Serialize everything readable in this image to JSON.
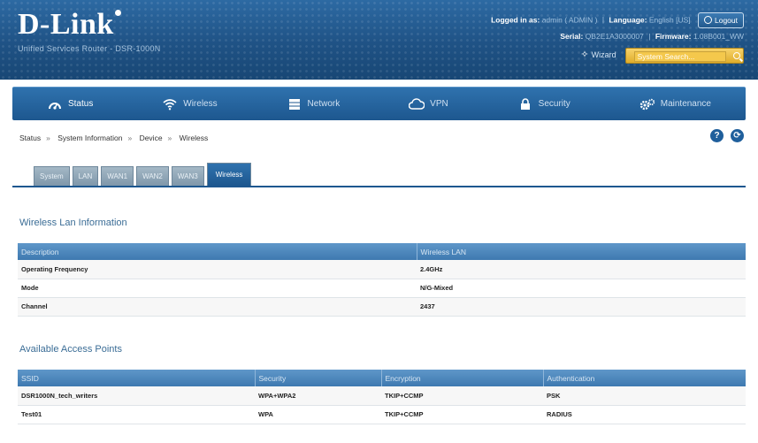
{
  "header": {
    "logo": "D-Link",
    "tagline": "Unified Services Router - DSR-1000N",
    "logged_in_label": "Logged in as:",
    "logged_in_value": "admin ( ADMIN )",
    "language_label": "Language:",
    "language_value": "English [US]",
    "logout_label": "Logout",
    "serial_label": "Serial:",
    "serial_value": "QB2E1A3000007",
    "firmware_label": "Firmware:",
    "firmware_value": "1.08B001_WW",
    "wizard_label": "Wizard",
    "search_placeholder": "System Search..."
  },
  "nav": {
    "items": [
      {
        "label": "Status",
        "icon": "dashboard-icon",
        "active": true
      },
      {
        "label": "Wireless",
        "icon": "wifi-icon",
        "active": false
      },
      {
        "label": "Network",
        "icon": "network-icon",
        "active": false
      },
      {
        "label": "VPN",
        "icon": "cloud-icon",
        "active": false
      },
      {
        "label": "Security",
        "icon": "lock-icon",
        "active": false
      },
      {
        "label": "Maintenance",
        "icon": "gears-icon",
        "active": false
      }
    ]
  },
  "breadcrumb": [
    "Status",
    "System Information",
    "Device",
    "Wireless"
  ],
  "tabs": [
    {
      "label": "System",
      "active": false
    },
    {
      "label": "LAN",
      "active": false
    },
    {
      "label": "WAN1",
      "active": false
    },
    {
      "label": "WAN2",
      "active": false
    },
    {
      "label": "WAN3",
      "active": false
    },
    {
      "label": "Wireless",
      "active": true
    }
  ],
  "wlan_info": {
    "title": "Wireless Lan Information",
    "headers": [
      "Description",
      "Wireless LAN"
    ],
    "rows": [
      [
        "Operating Frequency",
        "2.4GHz"
      ],
      [
        "Mode",
        "N/G-Mixed"
      ],
      [
        "Channel",
        "2437"
      ]
    ]
  },
  "access_points": {
    "title": "Available Access Points",
    "headers": [
      "SSID",
      "Security",
      "Encryption",
      "Authentication"
    ],
    "rows": [
      [
        "DSR1000N_tech_writers",
        "WPA+WPA2",
        "TKIP+CCMP",
        "PSK"
      ],
      [
        "Test01",
        "WPA",
        "TKIP+CCMP",
        "RADIUS"
      ]
    ]
  },
  "colors": {
    "header_blue": "#1f5285",
    "nav_blue": "#1d578f",
    "table_header_blue": "#4f8bc2",
    "search_gold": "#e8b93a"
  }
}
